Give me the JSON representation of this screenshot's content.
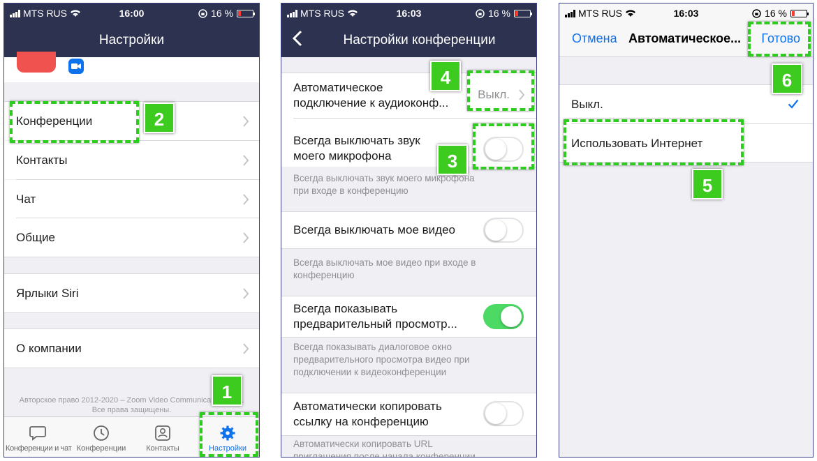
{
  "status": {
    "carrier": "MTS RUS",
    "battery": "16 %",
    "time_1": "16:00",
    "time_2": "16:03",
    "time_3": "16:03"
  },
  "screen1": {
    "title": "Настройки",
    "items": [
      {
        "label": "Конференции"
      },
      {
        "label": "Контакты"
      },
      {
        "label": "Чат"
      },
      {
        "label": "Общие"
      },
      {
        "label": "Ярлыки Siri"
      },
      {
        "label": "О компании"
      }
    ],
    "copyright_line1": "Авторское право 2012-2020 – Zoom Video Communications, Inc.",
    "copyright_line2": "Все права защищены.",
    "tabs": [
      {
        "label": "Конференции и чат",
        "icon": "chat-bubble-icon"
      },
      {
        "label": "Конференции",
        "icon": "clock-icon"
      },
      {
        "label": "Контакты",
        "icon": "contact-icon"
      },
      {
        "label": "Настройки",
        "icon": "gear-icon"
      }
    ],
    "active_tab": "Настройки"
  },
  "screen2": {
    "title": "Настройки конференции",
    "auto_connect_line1": "Автоматическое",
    "auto_connect_line2": "подключение к аудиоконф...",
    "auto_connect_value": "Выкл.",
    "mute_mic_line1": "Всегда выключать звук",
    "mute_mic_line2": "моего микрофона",
    "mute_mic_desc_line1": "Всегда выключать звук моего микрофона",
    "mute_mic_desc_line2": "при входе в конференцию",
    "mute_mic_on": false,
    "video_off_label": "Всегда выключать мое видео",
    "video_off_desc_line1": "Всегда выключать мое видео при входе в",
    "video_off_desc_line2": "конференцию",
    "video_off_on": false,
    "preview_line1": "Всегда показывать",
    "preview_line2": "предварительный просмотр...",
    "preview_desc_line1": "Всегда показывать диалоговое окно",
    "preview_desc_line2": "предварительного просмотра видео при",
    "preview_desc_line3": "подключении к видеоконференции",
    "preview_on": true,
    "copy_link_line1": "Автоматически копировать",
    "copy_link_line2": "ссылку на конференцию",
    "copy_link_desc_line1": "Автоматически копировать URL",
    "copy_link_desc_line2": "приглашения после начала конференции",
    "copy_link_on": false
  },
  "screen3": {
    "cancel_label": "Отмена",
    "title": "Автоматическое...",
    "done_label": "Готово",
    "options": [
      {
        "label": "Выкл.",
        "selected": true
      },
      {
        "label": "Использовать Интернет",
        "selected": false
      }
    ]
  },
  "badges": {
    "b1": "1",
    "b2": "2",
    "b3": "3",
    "b4": "4",
    "b5": "5",
    "b6": "6"
  },
  "colors": {
    "nav_dark": "#2d3250",
    "ios_blue": "#0e72ed",
    "callout_green": "#2ecc1e",
    "toggle_on": "#4cd964",
    "red_icon": "#f0524f"
  }
}
